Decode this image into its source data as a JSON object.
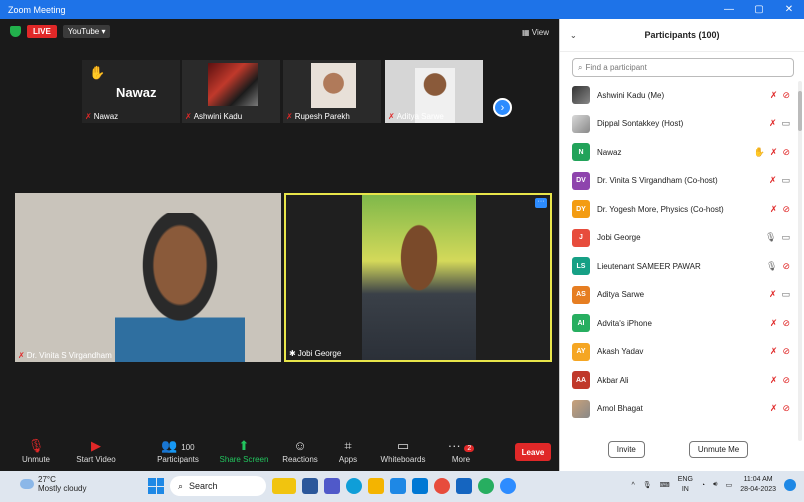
{
  "window": {
    "title": "Zoom Meeting",
    "controls": [
      "—",
      "▢",
      "✕"
    ]
  },
  "topbar": {
    "live": "LIVE",
    "stream": "YouTube ▾",
    "view": "View"
  },
  "thumbs": [
    {
      "name": "Nawaz",
      "big": "Nawaz"
    },
    {
      "name": "Ashwini Kadu"
    },
    {
      "name": "Rupesh Parekh"
    },
    {
      "name": "Aditya Sarwe"
    }
  ],
  "main_tiles": [
    {
      "name": "Dr. Vinita  S Virgandham"
    },
    {
      "name": "Jobi George"
    }
  ],
  "toolbar": {
    "unmute": "Unmute",
    "start_video": "Start Video",
    "participants": "Participants",
    "participants_count": "100",
    "share": "Share Screen",
    "reactions": "Reactions",
    "apps": "Apps",
    "whiteboards": "Whiteboards",
    "more": "More",
    "more_badge": "2",
    "leave": "Leave"
  },
  "panel": {
    "title": "Participants (100)",
    "search_placeholder": "Find a participant",
    "invite": "Invite",
    "unmute_me": "Unmute Me",
    "participants": [
      {
        "initials": "",
        "name": "Ashwini Kadu (Me)",
        "color": "#333333",
        "mic": "off",
        "video": "off",
        "hand": false,
        "photo": true
      },
      {
        "initials": "",
        "name": "Dippal Sontakkey (Host)",
        "color": "#d9d9d9",
        "mic": "off",
        "video": "on",
        "hand": false,
        "photo": true
      },
      {
        "initials": "N",
        "name": "Nawaz",
        "color": "#22a35a",
        "mic": "off",
        "video": "off",
        "hand": true
      },
      {
        "initials": "DV",
        "name": "Dr. Vinita  S Virgandham (Co-host)",
        "color": "#8e44ad",
        "mic": "off",
        "video": "on",
        "hand": false
      },
      {
        "initials": "DY",
        "name": "Dr. Yogesh More, Physics (Co-host)",
        "color": "#f39c12",
        "mic": "off",
        "video": "off",
        "hand": false
      },
      {
        "initials": "J",
        "name": "Jobi George",
        "color": "#e74c3c",
        "mic": "on",
        "video": "on",
        "hand": false
      },
      {
        "initials": "LS",
        "name": "Lieutenant SAMEER PAWAR",
        "color": "#16a085",
        "mic": "on",
        "video": "off",
        "hand": false
      },
      {
        "initials": "AS",
        "name": "Aditya Sarwe",
        "color": "#e67e22",
        "mic": "off",
        "video": "on",
        "hand": false
      },
      {
        "initials": "AI",
        "name": "Advita's iPhone",
        "color": "#27ae60",
        "mic": "off",
        "video": "off",
        "hand": false
      },
      {
        "initials": "AY",
        "name": "Akash Yadav",
        "color": "#f5a623",
        "mic": "off",
        "video": "off",
        "hand": false
      },
      {
        "initials": "AA",
        "name": "Akbar Ali",
        "color": "#c0392b",
        "mic": "off",
        "video": "off",
        "hand": false
      },
      {
        "initials": "",
        "name": "Amol Bhagat",
        "color": "#caa27a",
        "mic": "off",
        "video": "off",
        "hand": false,
        "photo": true
      }
    ]
  },
  "taskbar": {
    "temp": "27°C",
    "weather": "Mostly cloudy",
    "search": "Search",
    "lang": "ENG",
    "lang2": "IN",
    "time": "11:04 AM",
    "date": "28-04-2023"
  }
}
